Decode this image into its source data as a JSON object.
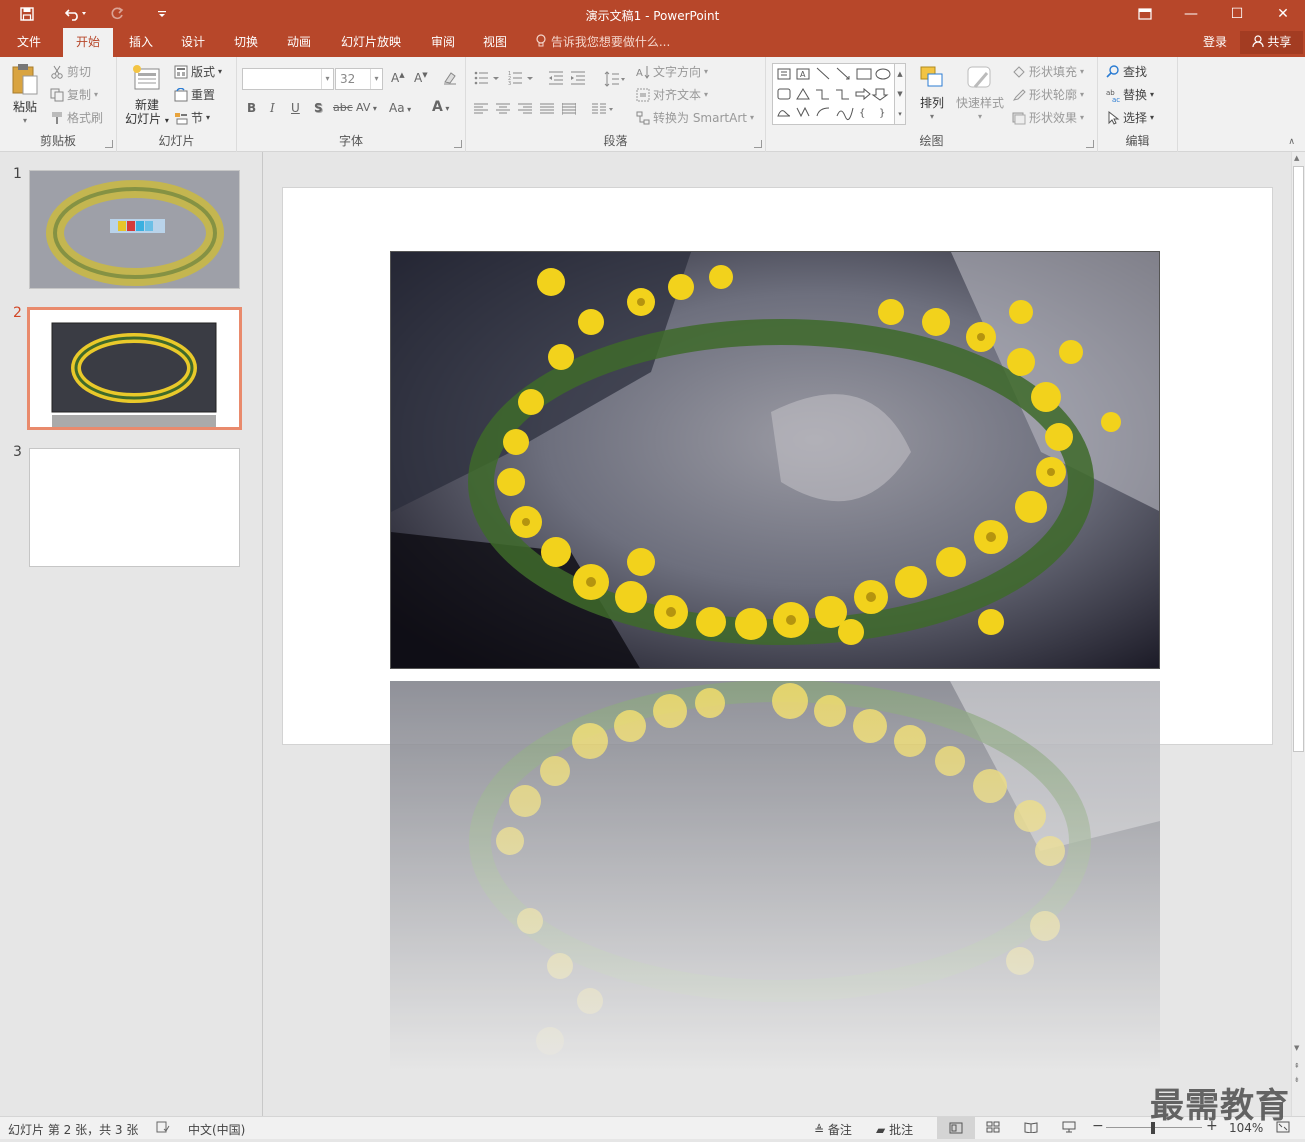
{
  "window": {
    "title": "演示文稿1 - PowerPoint"
  },
  "quick_access": {
    "save_icon": "save-icon",
    "undo_icon": "undo-icon",
    "redo_icon": "redo-icon",
    "customize_icon": "customize-icon"
  },
  "window_controls": {
    "restore_icon": "ribbon-display-icon",
    "minimize": "—",
    "maximize": "☐",
    "close": "✕"
  },
  "tabs": [
    {
      "label": "文件"
    },
    {
      "label": "开始"
    },
    {
      "label": "插入"
    },
    {
      "label": "设计"
    },
    {
      "label": "切换"
    },
    {
      "label": "动画"
    },
    {
      "label": "幻灯片放映"
    },
    {
      "label": "审阅"
    },
    {
      "label": "视图"
    }
  ],
  "active_tab": "开始",
  "tell_me": {
    "placeholder": "告诉我您想要做什么..."
  },
  "account": {
    "login": "登录",
    "share": "共享"
  },
  "ribbon": {
    "clipboard": {
      "label": "剪贴板",
      "paste": "粘贴",
      "cut": "剪切",
      "copy": "复制",
      "format_painter": "格式刷"
    },
    "slides": {
      "label": "幻灯片",
      "new_slide_line1": "新建",
      "new_slide_line2": "幻灯片",
      "layout": "版式",
      "reset": "重置",
      "section": "节"
    },
    "font": {
      "label": "字体",
      "font_name": "",
      "font_size": "32",
      "bold": "B",
      "italic": "I",
      "underline": "U",
      "shadow": "S",
      "strike": "abc",
      "spacing": "AV",
      "case": "Aa",
      "color": "A"
    },
    "paragraph": {
      "label": "段落",
      "text_direction": "文字方向",
      "align_text": "对齐文本",
      "smartart": "转换为 SmartArt"
    },
    "drawing": {
      "label": "绘图",
      "arrange": "排列",
      "quick_styles": "快速样式",
      "shape_fill": "形状填充",
      "shape_outline": "形状轮廓",
      "shape_effects": "形状效果"
    },
    "editing": {
      "label": "编辑",
      "find": "查找",
      "replace": "替换",
      "select": "选择"
    }
  },
  "thumbnails": [
    {
      "number": "1",
      "selected": false
    },
    {
      "number": "2",
      "selected": true
    },
    {
      "number": "3",
      "selected": false
    }
  ],
  "status": {
    "slide_info": "幻灯片 第 2 张，共 3 张",
    "language": "中文(中国)",
    "notes": "备注",
    "comments": "批注",
    "zoom": "104%"
  },
  "watermark": "最需教育",
  "colors": {
    "accent": "#b7472a",
    "ribbon_bg": "#f1f1f1",
    "selected_thumb": "#e98a6c"
  }
}
